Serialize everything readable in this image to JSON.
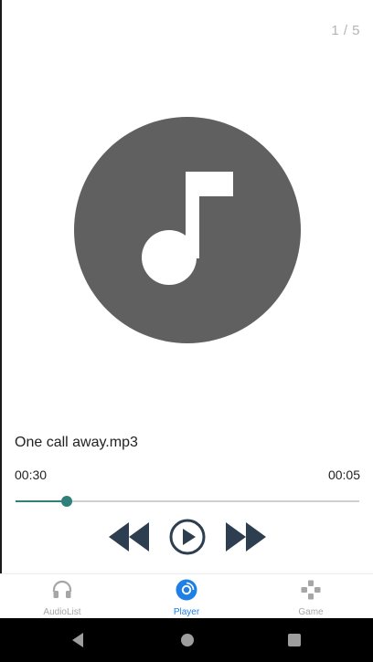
{
  "player": {
    "page_indicator": "1 / 5",
    "track_name": "One call away.mp3",
    "current_time": "00:30",
    "total_time": "00:05",
    "progress_fraction": 0.15,
    "artwork_icon": "music-note-icon"
  },
  "controls": {
    "prev_icon": "rewind-icon",
    "play_icon": "play-icon",
    "next_icon": "fast-forward-icon"
  },
  "bottom_nav": {
    "items": [
      {
        "label": "AudioList",
        "icon": "headphones-icon",
        "active": false
      },
      {
        "label": "Player",
        "icon": "disc-icon",
        "active": true
      },
      {
        "label": "Game",
        "icon": "gamepad-icon",
        "active": false
      }
    ]
  },
  "system_bar": {
    "back_icon": "back-triangle-icon",
    "home_icon": "home-circle-icon",
    "recent_icon": "recent-square-icon"
  },
  "colors": {
    "accent": "#2f7f7a",
    "nav_active": "#1e7fe6",
    "nav_inactive": "#a6a6a6",
    "controls": "#2c3e4f",
    "artwork": "#606060"
  }
}
